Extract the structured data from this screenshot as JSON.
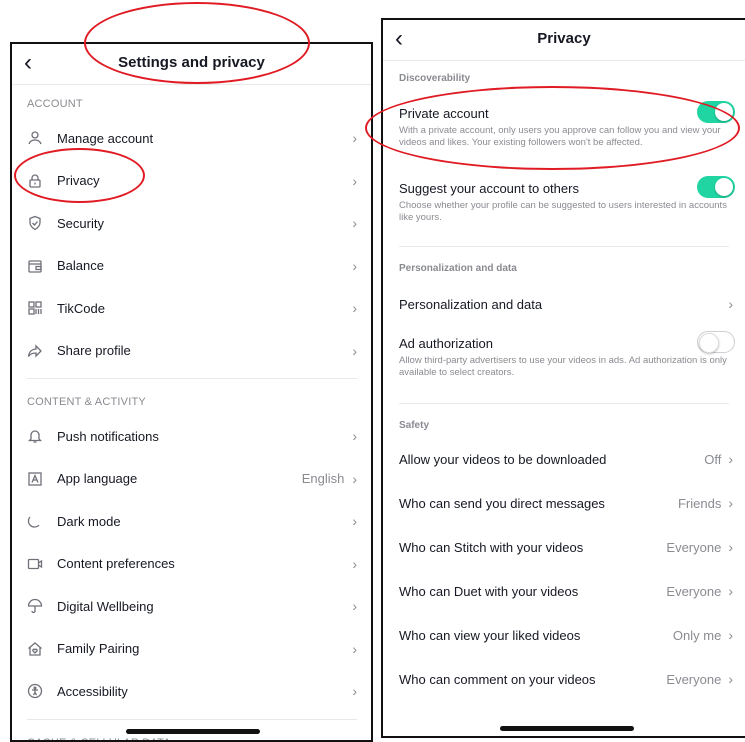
{
  "left": {
    "title": "Settings and privacy",
    "back_icon": "chevron-left-icon",
    "sections": [
      {
        "header": "ACCOUNT",
        "items": [
          {
            "icon": "person-icon",
            "label": "Manage account",
            "value": ""
          },
          {
            "icon": "lock-icon",
            "label": "Privacy",
            "value": ""
          },
          {
            "icon": "shield-icon",
            "label": "Security",
            "value": ""
          },
          {
            "icon": "wallet-icon",
            "label": "Balance",
            "value": ""
          },
          {
            "icon": "qr-code-icon",
            "label": "TikCode",
            "value": ""
          },
          {
            "icon": "share-icon",
            "label": "Share profile",
            "value": ""
          }
        ]
      },
      {
        "header": "CONTENT & ACTIVITY",
        "items": [
          {
            "icon": "bell-icon",
            "label": "Push notifications",
            "value": ""
          },
          {
            "icon": "language-icon",
            "label": "App language",
            "value": "English"
          },
          {
            "icon": "moon-icon",
            "label": "Dark mode",
            "value": ""
          },
          {
            "icon": "video-icon",
            "label": "Content preferences",
            "value": ""
          },
          {
            "icon": "umbrella-icon",
            "label": "Digital Wellbeing",
            "value": ""
          },
          {
            "icon": "home-heart-icon",
            "label": "Family Pairing",
            "value": ""
          },
          {
            "icon": "accessibility-icon",
            "label": "Accessibility",
            "value": ""
          }
        ]
      }
    ],
    "partial_header": "CACHE & CELLULAR DATA"
  },
  "right": {
    "title": "Privacy",
    "back_icon": "chevron-left-icon",
    "discoverability": {
      "header": "Discoverability",
      "private_account": {
        "label": "Private account",
        "desc": "With a private account, only users you approve can follow you and view your videos and likes. Your existing followers won't be affected.",
        "on": true
      },
      "suggest_account": {
        "label": "Suggest your account to others",
        "desc": "Choose whether your profile can be suggested to users interested in accounts like yours.",
        "on": true
      }
    },
    "personalization": {
      "header": "Personalization and data",
      "row_label": "Personalization and data",
      "ad_auth": {
        "label": "Ad authorization",
        "desc": "Allow third-party advertisers to use your videos in ads. Ad authorization is only available to select creators.",
        "on": false
      }
    },
    "safety": {
      "header": "Safety",
      "rows": [
        {
          "label": "Allow your videos to be downloaded",
          "value": "Off"
        },
        {
          "label": "Who can send you direct messages",
          "value": "Friends"
        },
        {
          "label": "Who can Stitch with your videos",
          "value": "Everyone"
        },
        {
          "label": "Who can Duet with your videos",
          "value": "Everyone"
        },
        {
          "label": "Who can view your liked videos",
          "value": "Only me"
        },
        {
          "label": "Who can comment on your videos",
          "value": "Everyone"
        }
      ]
    }
  },
  "colors": {
    "toggle_on": "#20d5a2",
    "annotation": "#e01b24"
  }
}
